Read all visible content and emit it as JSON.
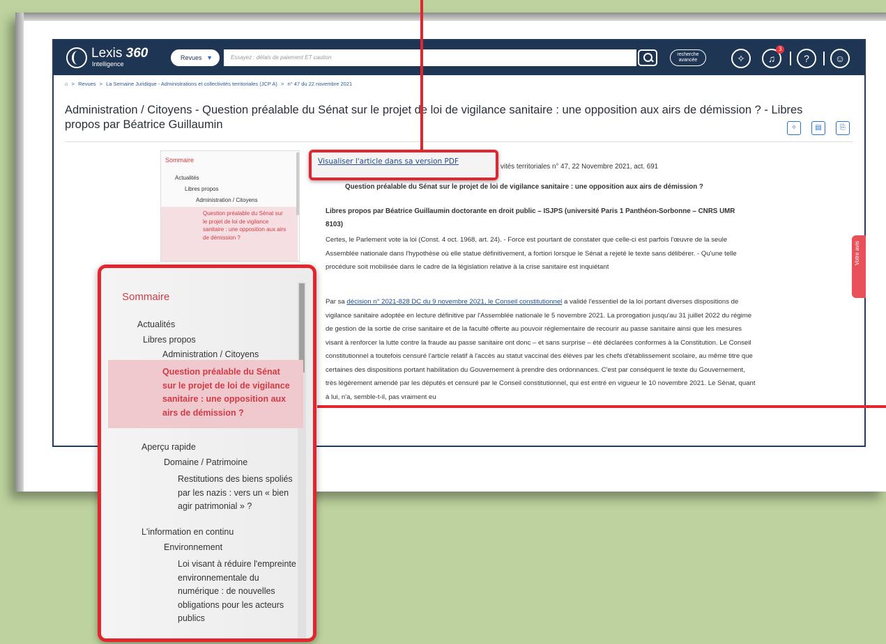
{
  "header": {
    "brand_name": "Lexis",
    "brand_num": "360",
    "brand_sub": "Intelligence",
    "scope": "Revues",
    "search_placeholder": "Essayez : délais de paiement ET caution",
    "adv_line1": "recherche",
    "adv_line2": "avancée",
    "notif_count": "3",
    "help": "?"
  },
  "breadcrumb": {
    "items": [
      "Revues",
      "La Semaine Juridique - Administrations et collectivités territoriales (JCP A)",
      "n° 47 du 22 novembre 2021"
    ],
    "sep": ">"
  },
  "page_title": "Administration / Citoyens - Question préalable du Sénat sur le projet de loi de vigilance sanitaire : une opposition aux airs de démission ? - Libres propos par Béatrice Guillaumin",
  "toc": {
    "heading": "Sommaire",
    "l1": "Actualités",
    "l2": "Libres propos",
    "l3": "Administration / Citoyens",
    "active": "Question préalable du Sénat sur le projet de loi de vigilance sanitaire : une opposition aux airs de démission ?",
    "s2_l1": "Aperçu rapide",
    "s2_l2": "Domaine / Patrimoine",
    "s2_l3": "Restitutions des biens spoliés par les nazis : vers un « bien agir patrimonial » ?",
    "s3_l1": "L'information en continu",
    "s3_l2": "Environnement",
    "s3_l3": "Loi visant à réduire l'empreinte environnementale du numérique : de nouvelles obligations pour les acteurs publics"
  },
  "article": {
    "pdf_link": "Visualiser l'article dans sa version PDF",
    "source": "vités territoriales n° 47, 22 Novembre 2021, act. 691",
    "subtitle": "Question préalable du Sénat sur le projet de loi de vigilance sanitaire : une opposition aux airs de démission ?",
    "author": "Libres propos par Béatrice Guillaumin doctorante en droit public – ISJPS (université Paris 1 Panthéon-Sorbonne – CNRS UMR 8103)",
    "p1": "Certes, le Parlement vote la loi (Const. 4 oct. 1968, art. 24). - Force est pourtant de constater que celle-ci est parfois l'œuvre de la seule Assemblée nationale dans l'hypothèse où elle statue définitivement, a fortiori lorsque le Sénat a rejeté le texte sans délibérer. - Qu'une telle procédure soit mobilisée dans le cadre de la législation relative à la crise sanitaire est inquiétant",
    "p2_pre": "Par sa ",
    "p2_link": "décision n° 2021-828 DC du 9 novembre 2021, le Conseil constitutionnel",
    "p2_post": " a validé l'essentiel de la loi portant diverses dispositions de vigilance sanitaire adoptée en lecture définitive par l'Assemblée nationale le 5 novembre 2021. La prorogation jusqu'au 31 juillet 2022 du régime de gestion de la sortie de crise sanitaire et de la faculté offerte au pouvoir réglementaire de recourir au passe sanitaire ainsi que les mesures visant à renforcer la lutte contre la fraude au passe sanitaire ont donc – et sans surprise – été déclarées conformes à la Constitution. Le Conseil constitutionnel a toutefois censuré l'article relatif à l'accès au statut vaccinal des élèves par les chefs d'établissement scolaire, au même titre que certaines des dispositions portant habilitation du Gouvernement à prendre des ordonnances. C'est par conséquent le texte du Gouvernement, très légèrement amendé par les députés et censuré par le Conseil constitutionnel, qui est entré en vigueur le 10 novembre 2021. Le Sénat, quant à lui, n'a, semble-t-il, pas vraiment eu"
  },
  "feedback": "Votre avis",
  "colors": {
    "accent": "#e3262e",
    "nav": "#1e3553",
    "link": "#1f4d8c",
    "toc_active": "#d23b46"
  }
}
